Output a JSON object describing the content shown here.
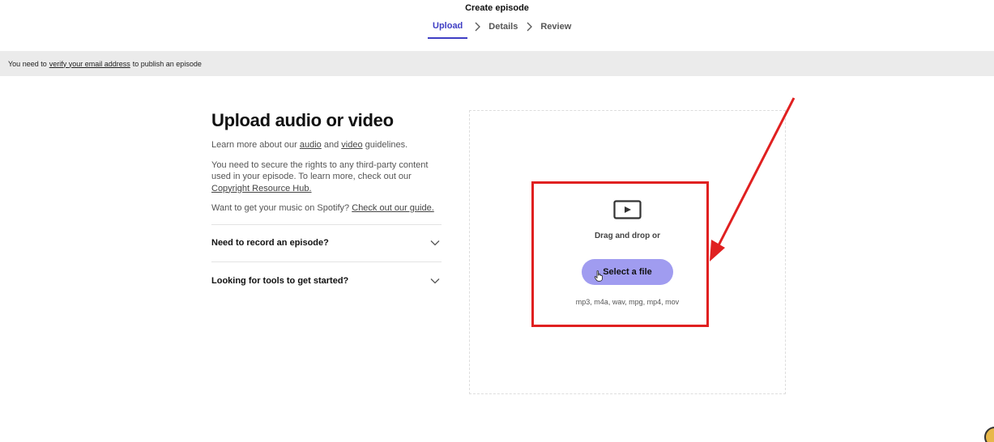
{
  "header": {
    "title": "Create episode",
    "steps": [
      {
        "label": "Upload",
        "active": true
      },
      {
        "label": "Details",
        "active": false
      },
      {
        "label": "Review",
        "active": false
      }
    ]
  },
  "banner": {
    "prefix": "You need to",
    "link": "verify your email address",
    "suffix": "to publish an episode"
  },
  "left": {
    "title": "Upload audio or video",
    "guidelines": {
      "prefix": "Learn more about our",
      "audio_link": "audio",
      "and": "and",
      "video_link": "video",
      "suffix": "guidelines."
    },
    "rights": {
      "text": "You need to secure the rights to any third-party content used in your episode. To learn more, check out our",
      "link": "Copyright Resource Hub."
    },
    "music": {
      "text": "Want to get your music on Spotify?",
      "link": "Check out our guide."
    },
    "accordion": [
      {
        "label": "Need to record an episode?"
      },
      {
        "label": "Looking for tools to get started?"
      }
    ]
  },
  "upload": {
    "icon": "video-play-icon",
    "drag_text": "Drag and drop or",
    "button_label": "Select a file",
    "formats": "mp3, m4a, wav, mpg, mp4, mov"
  },
  "colors": {
    "accent": "#3f3ec4",
    "button": "#a09cf0",
    "annotation": "#e02020",
    "banner_bg": "#ebebeb"
  }
}
